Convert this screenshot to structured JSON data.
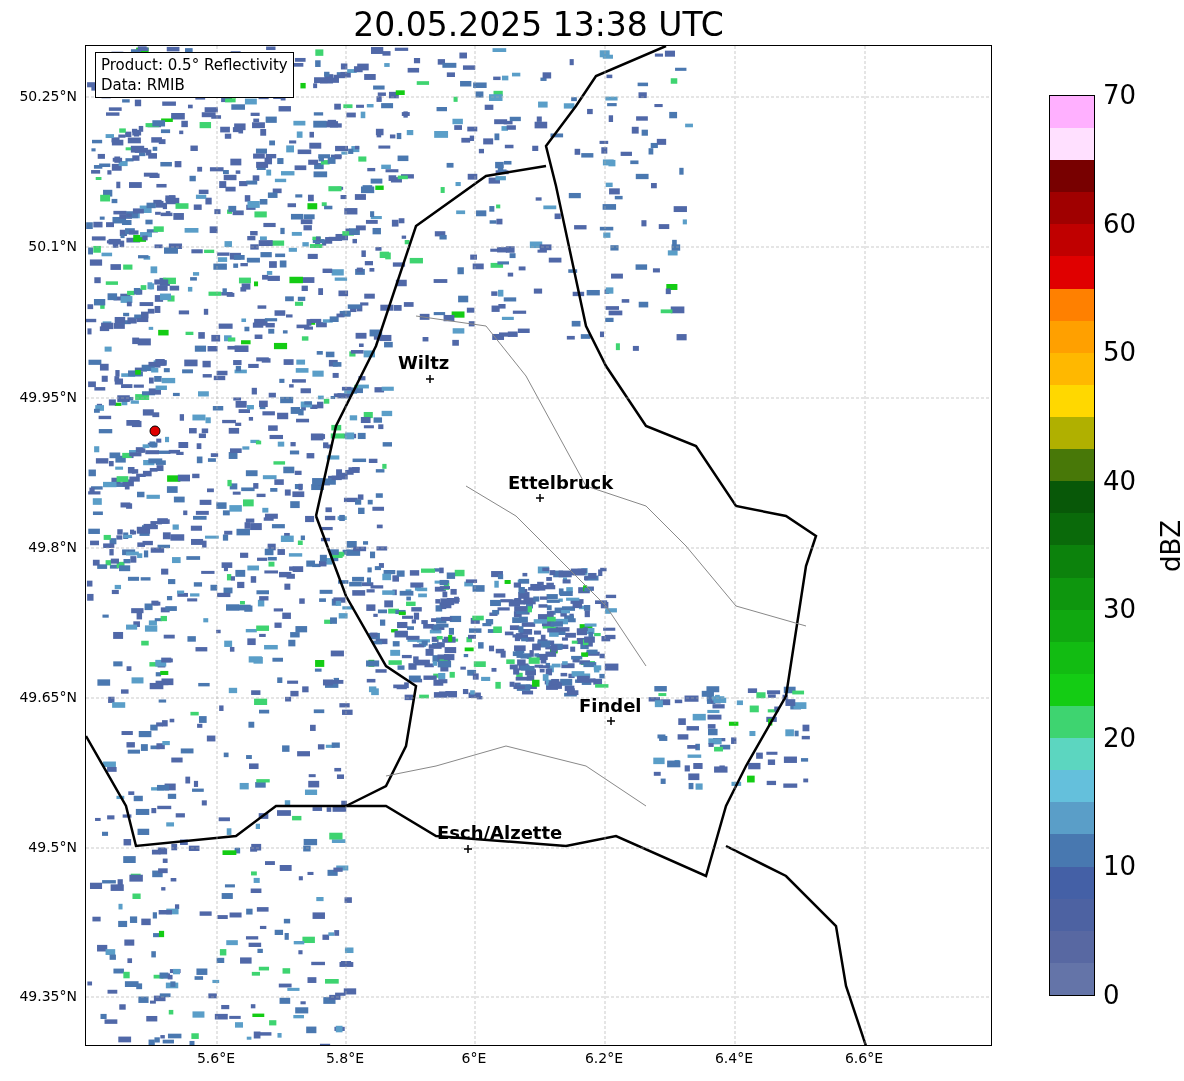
{
  "title": "20.05.2025 13:38 UTC",
  "info": {
    "product": "Product: 0.5° Reflectivity",
    "data": "Data: RMIB"
  },
  "x_ticks": [
    "5.6°E",
    "5.8°E",
    "6°E",
    "6.2°E",
    "6.4°E",
    "6.6°E"
  ],
  "y_ticks": [
    "50.25°N",
    "50.1°N",
    "49.95°N",
    "49.8°N",
    "49.65°N",
    "49.5°N",
    "49.35°N"
  ],
  "cities": [
    {
      "name": "Wiltz"
    },
    {
      "name": "Ettelbruck"
    },
    {
      "name": "Findel"
    },
    {
      "name": "Esch/Alzette"
    }
  ],
  "colorbar": {
    "label": "dBZ",
    "ticks": [
      "70",
      "60",
      "50",
      "40",
      "30",
      "20",
      "10",
      "0"
    ]
  }
}
